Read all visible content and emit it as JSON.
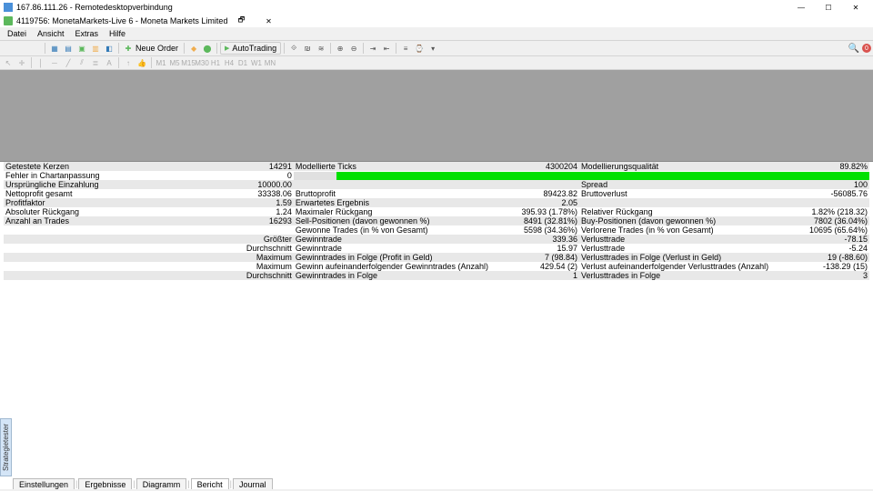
{
  "window1": {
    "title": "167.86.111.26 - Remotedesktopverbindung"
  },
  "window2": {
    "title": "4119756: MonetaMarkets-Live 6 - Moneta Markets Limited"
  },
  "window2_btns": {
    "restore": "🗗",
    "close": "✕"
  },
  "menu": {
    "datei": "Datei",
    "ansicht": "Ansicht",
    "extras": "Extras",
    "hilfe": "Hilfe"
  },
  "toolbar": {
    "neue_order": "Neue Order",
    "autotrading": "AutoTrading",
    "notif_count": "0"
  },
  "report": {
    "r1": {
      "c1l": "Getestete Kerzen",
      "c1v": "14291",
      "c2l": "Modellierte Ticks",
      "c2v": "4300204",
      "c3l": "Modellierungsqualität",
      "c3v": "89.82%"
    },
    "r2": {
      "c1l": "Fehler in Chartanpassung",
      "c1v": "0"
    },
    "r3": {
      "c1l": "Ursprüngliche Einzahlung",
      "c1v": "10000.00",
      "c3l": "Spread",
      "c3v": "100"
    },
    "r4": {
      "c1l": "Nettoprofit gesamt",
      "c1v": "33338.06",
      "c2l": "Bruttoprofit",
      "c2v": "89423.82",
      "c3l": "Bruttoverlust",
      "c3v": "-56085.76"
    },
    "r5": {
      "c1l": "Profitfaktor",
      "c1v": "1.59",
      "c2l": "Erwartetes Ergebnis",
      "c2v": "2.05"
    },
    "r6": {
      "c1l": "Absoluter Rückgang",
      "c1v": "1.24",
      "c2l": "Maximaler Rückgang",
      "c2v": "395.93 (1.78%)",
      "c3l": "Relativer Rückgang",
      "c3v": "1.82% (218.32)"
    },
    "r7": {
      "c1l": "Anzahl an Trades",
      "c1v": "16293",
      "c2l": "Sell-Positionen (davon gewonnen %)",
      "c2v": "8491 (32.81%)",
      "c3l": "Buy-Positionen (davon gewonnen %)",
      "c3v": "7802 (36.04%)"
    },
    "r8": {
      "c2l": "Gewonne Trades (in % von Gesamt)",
      "c2v": "5598 (34.36%)",
      "c3l": "Verlorene Trades (in % von Gesamt)",
      "c3v": "10695 (65.64%)"
    },
    "r9": {
      "c1l": "Größter",
      "c2l": "Gewinntrade",
      "c2v": "339.36",
      "c3l": "Verlusttrade",
      "c3v": "-78.15"
    },
    "r10": {
      "c1l": "Durchschnitt",
      "c2l": "Gewinntrade",
      "c2v": "15.97",
      "c3l": "Verlusttrade",
      "c3v": "-5.24"
    },
    "r11": {
      "c1l": "Maximum",
      "c2l": "Gewinntrades in Folge (Profit in Geld)",
      "c2v": "7 (98.84)",
      "c3l": "Verlusttrades in Folge (Verlust in Geld)",
      "c3v": "19 (-88.60)"
    },
    "r12": {
      "c1l": "Maximum",
      "c2l": "Gewinn aufeinanderfolgender Gewinntrades (Anzahl)",
      "c2v": "429.54 (2)",
      "c3l": "Verlust aufeinanderfolgender Verlusttrades (Anzahl)",
      "c3v": "-138.29 (15)"
    },
    "r13": {
      "c1l": "Durchschnitt",
      "c2l": "Gewinntrades in Folge",
      "c2v": "1",
      "c3l": "Verlusttrades in Folge",
      "c3v": "3"
    }
  },
  "tabs": {
    "einstellungen": "Einstellungen",
    "ergebnisse": "Ergebnisse",
    "diagramm": "Diagramm",
    "bericht": "Bericht",
    "journal": "Journal"
  },
  "sideflag": "Strategietester"
}
